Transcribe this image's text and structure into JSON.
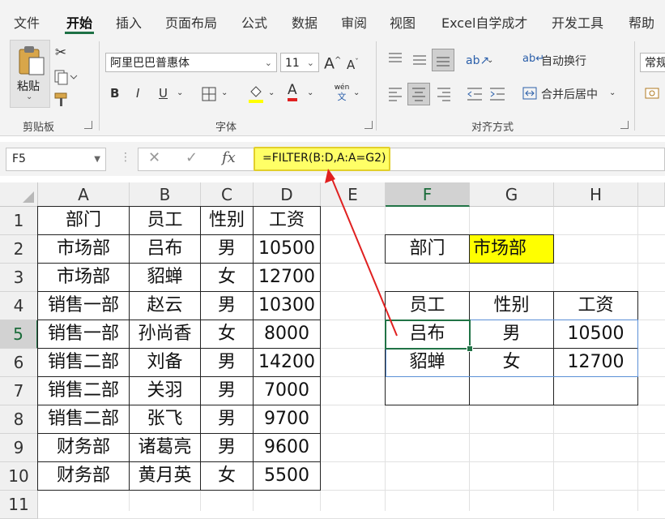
{
  "tabs": [
    "文件",
    "开始",
    "插入",
    "页面布局",
    "公式",
    "数据",
    "审阅",
    "视图",
    "Excel自学成才",
    "开发工具",
    "帮助"
  ],
  "active_tab": "开始",
  "ribbon": {
    "clipboard": {
      "paste_label": "粘贴",
      "group_label": "剪贴板"
    },
    "font": {
      "font_name": "阿里巴巴普惠体",
      "font_size": "11",
      "group_label": "字体",
      "bold": "B",
      "italic": "I",
      "underline": "U",
      "grow": "A",
      "shrink": "A",
      "font_color": "A",
      "phonetic_top": "wén",
      "phonetic_bottom": "文"
    },
    "alignment": {
      "wrap_text": "自动换行",
      "merge_center": "合并后居中",
      "group_label": "对齐方式"
    },
    "number": {
      "format": "常规"
    }
  },
  "formula_bar": {
    "name_box": "F5",
    "cancel": "✕",
    "enter": "✓",
    "fx": "fx",
    "formula": "=FILTER(B:D,A:A=G2)"
  },
  "sheet": {
    "columns": [
      "A",
      "B",
      "C",
      "D",
      "E",
      "F",
      "G",
      "H"
    ],
    "rows": [
      "1",
      "2",
      "3",
      "4",
      "5",
      "6",
      "7",
      "8",
      "9",
      "10",
      "11"
    ],
    "source_headers": [
      "部门",
      "员工",
      "性别",
      "工资"
    ],
    "source_rows": [
      [
        "市场部",
        "吕布",
        "男",
        "10500"
      ],
      [
        "市场部",
        "貂蝉",
        "女",
        "12700"
      ],
      [
        "销售一部",
        "赵云",
        "男",
        "10300"
      ],
      [
        "销售一部",
        "孙尚香",
        "女",
        "8000"
      ],
      [
        "销售二部",
        "刘备",
        "男",
        "14200"
      ],
      [
        "销售二部",
        "关羽",
        "男",
        "7000"
      ],
      [
        "销售二部",
        "张飞",
        "男",
        "9700"
      ],
      [
        "财务部",
        "诸葛亮",
        "男",
        "9600"
      ],
      [
        "财务部",
        "黄月英",
        "女",
        "5500"
      ]
    ],
    "criteria_label": "部门",
    "criteria_value": "市场部",
    "result_headers": [
      "员工",
      "性别",
      "工资"
    ],
    "result_rows": [
      [
        "吕布",
        "男",
        "10500"
      ],
      [
        "貂蝉",
        "女",
        "12700"
      ]
    ]
  },
  "colors": {
    "accent": "#217346",
    "highlight": "#ffff00",
    "arrow": "#e02020"
  }
}
